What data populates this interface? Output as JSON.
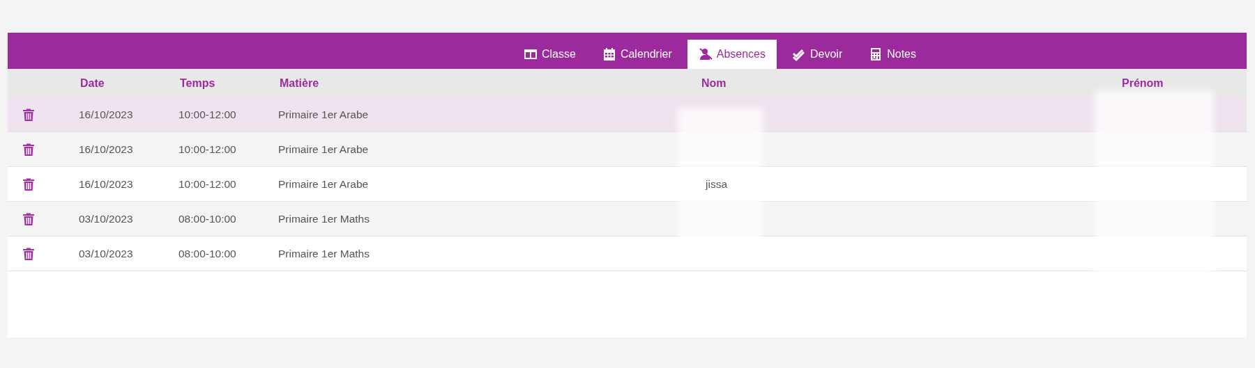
{
  "tabs": [
    {
      "label": "Classe",
      "kind": "columns",
      "selected": false
    },
    {
      "label": "Calendrier",
      "kind": "calendar",
      "selected": false
    },
    {
      "label": "Absences",
      "kind": "absence",
      "selected": true
    },
    {
      "label": "Devoir",
      "kind": "homework",
      "selected": false
    },
    {
      "label": "Notes",
      "kind": "grades",
      "selected": false
    }
  ],
  "table": {
    "columns": [
      "Date",
      "Temps",
      "Matière",
      "Nom",
      "Prénom"
    ],
    "rows": [
      {
        "date": "16/10/2023",
        "time": "10:00-12:00",
        "subject": "Primaire 1er Arabe",
        "selected": true
      },
      {
        "date": "16/10/2023",
        "time": "10:00-12:00",
        "subject": "Primaire 1er Arabe",
        "selected": false
      },
      {
        "date": "16/10/2023",
        "time": "10:00-12:00",
        "subject": "Primaire 1er Arabe",
        "nom": "jissa",
        "selected": false
      },
      {
        "date": "03/10/2023",
        "time": "08:00-10:00",
        "subject": "Primaire 1er Maths",
        "selected": false
      },
      {
        "date": "03/10/2023",
        "time": "08:00-10:00",
        "subject": "Primaire 1er Maths",
        "selected": false
      }
    ]
  }
}
